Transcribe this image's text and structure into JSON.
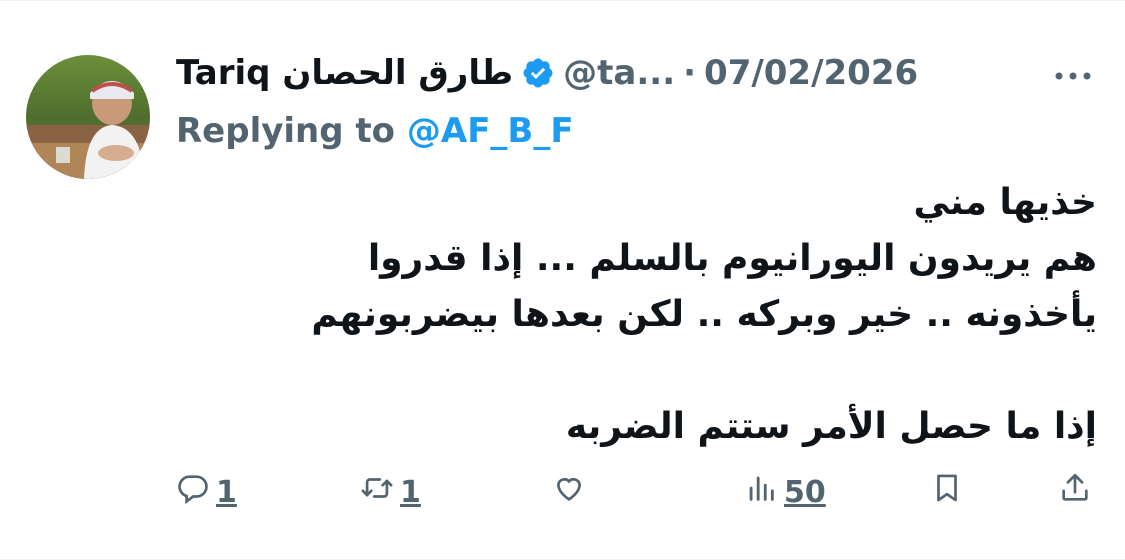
{
  "tweet": {
    "author_name": "Tariq طارق الحصان",
    "handle": "@ta...",
    "separator": "·",
    "date": "07/02/2026",
    "replying_prefix": "Replying to",
    "replying_mention": "@AF_B_F",
    "body_lines": [
      "خذيها مني",
      "هم يريدون اليورانيوم بالسلم ... إذا قدروا",
      "يأخذونه .. خير وبركه .. لكن بعدها بيضربونهم",
      "",
      "إذا ما حصل الأمر ستتم الضربه"
    ]
  },
  "actions": {
    "reply_count": "1",
    "retweet_count": "1",
    "views_count": "50"
  },
  "colors": {
    "verified_blue": "#1d9bf0",
    "muted_gray": "#536471",
    "mention_blue": "#1d9bf0"
  },
  "icons": [
    "verified-badge-icon",
    "more-options-icon",
    "reply-icon",
    "retweet-icon",
    "like-icon",
    "views-icon",
    "bookmark-icon",
    "share-icon"
  ]
}
